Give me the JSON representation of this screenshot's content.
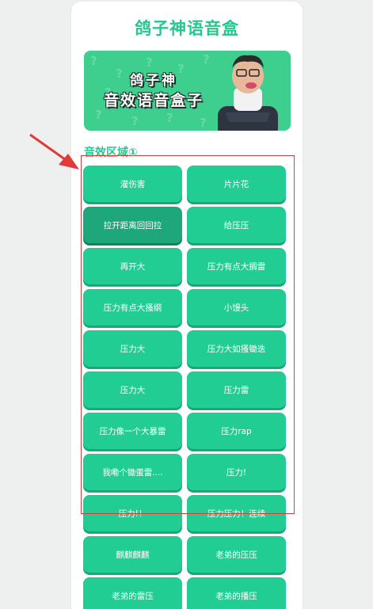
{
  "header": {
    "title": "鸽子神语音盒"
  },
  "banner": {
    "line1": "鸽子神",
    "line2": "音效语音盒子"
  },
  "section": {
    "title": "音效区域①"
  },
  "sounds": [
    "灌伤害",
    "片片花",
    "拉开距离回回拉",
    "给压压",
    "再开大",
    "压力有点大搁雷",
    "压力有点大搔纲",
    "小馒头",
    "压力大",
    "压力大如搔锄迭",
    "压力大",
    "压力雷",
    "压力像一个大暴雷",
    "压力rap",
    "我嘞个锄蛋雷....",
    "压力!",
    "压力!！",
    "压力压力！连续",
    "麒麒麒麒",
    "老弟的压压",
    "老弟的雷压",
    "老弟的播压"
  ],
  "active_index": 2,
  "colors": {
    "accent": "#22c98d",
    "button": "#22cd93",
    "highlight": "#e23a3a"
  }
}
